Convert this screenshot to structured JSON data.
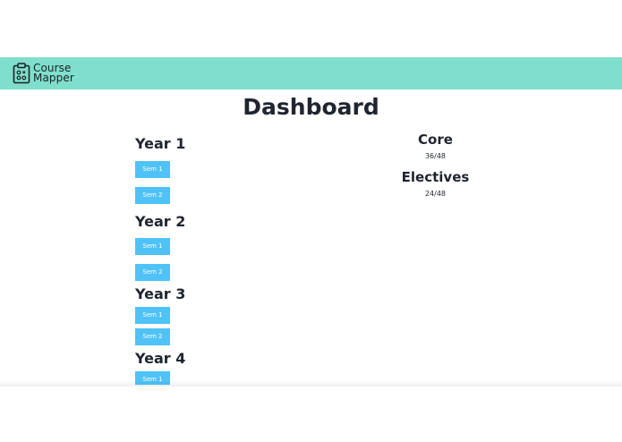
{
  "navbar": {
    "brand_line1": "Course",
    "brand_line2": "Mapper",
    "brand_icon": "clipboard-icon",
    "background": "#7fdecc"
  },
  "page": {
    "title": "Dashboard"
  },
  "years": [
    {
      "label": "Year 1",
      "sems": [
        "Sem 1",
        "Sem 2"
      ]
    },
    {
      "label": "Year 2",
      "sems": [
        "Sem 1",
        "Sem 2"
      ]
    },
    {
      "label": "Year 3",
      "sems": [
        "Sem 1",
        "Sem 2"
      ]
    },
    {
      "label": "Year 4",
      "sems": [
        "Sem 1"
      ]
    }
  ],
  "progress": {
    "core_label": "Core",
    "core_value": "36/48",
    "electives_label": "Electives",
    "electives_value": "24/48"
  },
  "colors": {
    "accent": "#4fc3f7",
    "text": "#1f2430"
  }
}
